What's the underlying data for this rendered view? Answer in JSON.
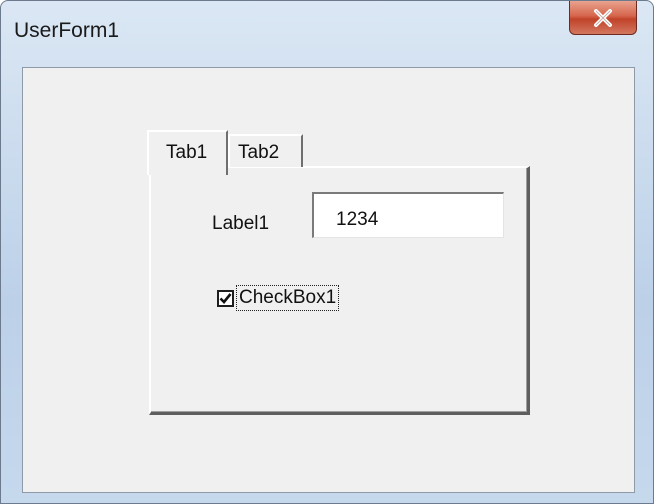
{
  "window": {
    "title": "UserForm1",
    "close_icon": "close-x-icon"
  },
  "tabs": [
    {
      "label": "Tab1",
      "selected": true
    },
    {
      "label": "Tab2",
      "selected": false
    }
  ],
  "page1": {
    "label": "Label1",
    "textbox_value": "1234",
    "checkbox": {
      "label": "CheckBox1",
      "checked": true,
      "check_icon": "checkmark-icon"
    }
  }
}
